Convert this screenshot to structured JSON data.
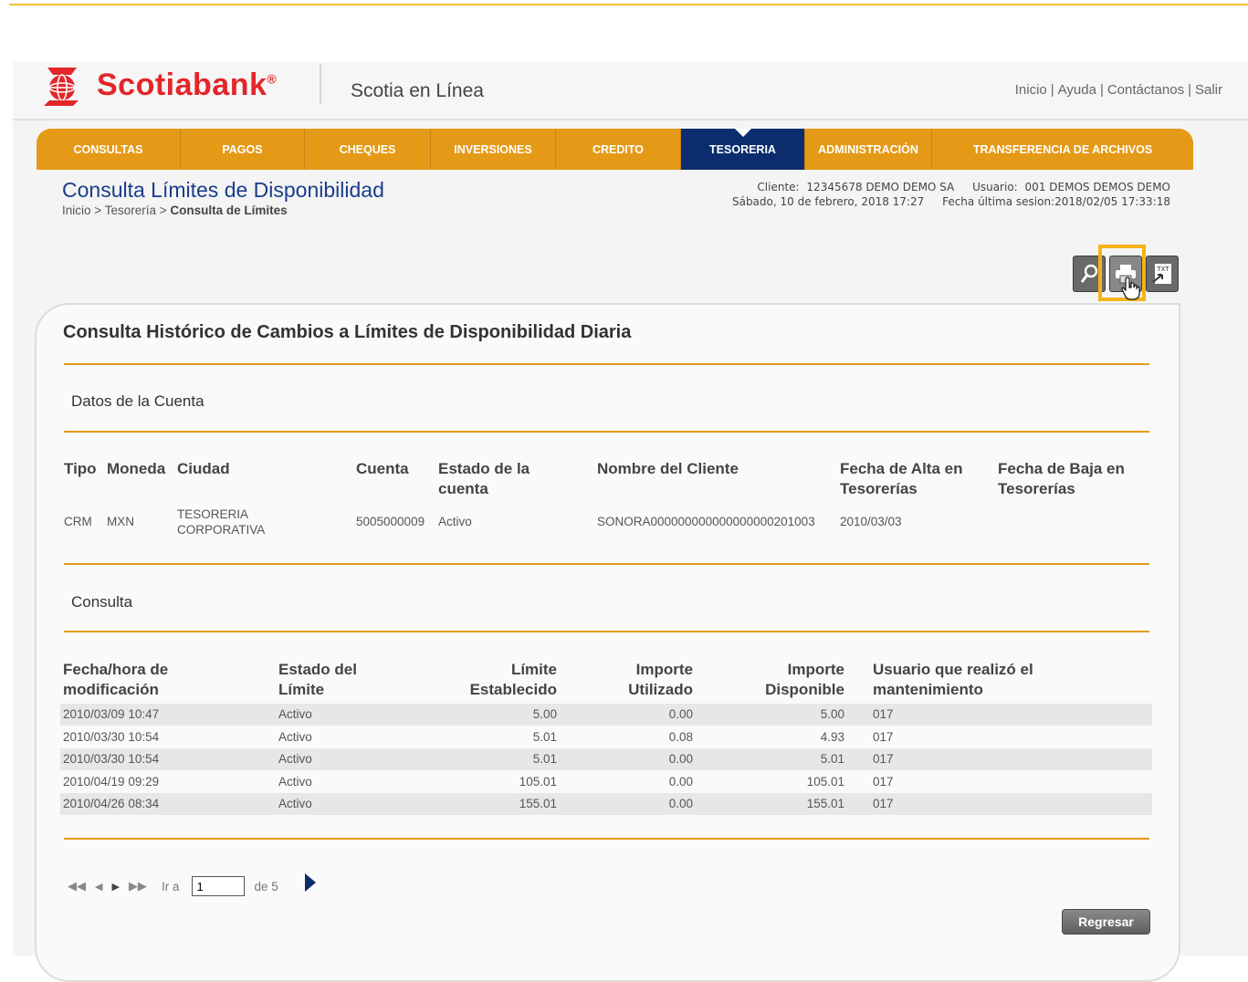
{
  "header": {
    "brand": "Scotiabank",
    "brand_mark": "®",
    "product": "Scotia en Línea",
    "links": [
      "Inicio",
      "Ayuda",
      "Contáctanos",
      "Salir"
    ]
  },
  "nav": {
    "items": [
      "CONSULTAS",
      "PAGOS",
      "CHEQUES",
      "INVERSIONES",
      "CREDITO",
      "TESORERIA",
      "ADMINISTRACIÓN",
      "TRANSFERENCIA DE ARCHIVOS"
    ],
    "active": "TESORERIA"
  },
  "page": {
    "title": "Consulta Límites de Disponibilidad",
    "breadcrumb": {
      "home": "Inicio",
      "sep": ">",
      "section": "Tesorería",
      "current": "Consulta de Límites"
    }
  },
  "session": {
    "cliente_label": "Cliente:",
    "cliente": "12345678 DEMO DEMO SA",
    "usuario_label": "Usuario:",
    "usuario": "001 DEMOS DEMOS DEMO",
    "fecha": "Sábado, 10 de febrero, 2018 17:27",
    "ultima_label": "Fecha última sesion:",
    "ultima": "2018/02/05 17:33:18"
  },
  "tools": {
    "icons": [
      "search-icon",
      "print-icon",
      "txt-export-icon"
    ],
    "txt_label": "TXT"
  },
  "panel": {
    "title": "Consulta Histórico de Cambios a Límites de Disponibilidad Diaria",
    "account_section": "Datos de la Cuenta",
    "account_headers": {
      "tipo": "Tipo",
      "moneda": "Moneda",
      "ciudad": "Ciudad",
      "cuenta": "Cuenta",
      "estado": "Estado de la cuenta",
      "nombre": "Nombre del Cliente",
      "alta": "Fecha de Alta en Tesorerías",
      "baja": "Fecha de Baja en Tesorerías"
    },
    "account_row": {
      "tipo": "CRM",
      "moneda": "MXN",
      "ciudad": "TESORERIA CORPORATIVA",
      "cuenta": "5005000009",
      "estado": "Activo",
      "nombre": "SONORA000000000000000000201003",
      "alta": "2010/03/03",
      "baja": ""
    },
    "query_section": "Consulta",
    "table_headers": {
      "fecha": "Fecha/hora de modificación",
      "estado": "Estado del Límite",
      "limite": "Límite Establecido",
      "utilizado": "Importe Utilizado",
      "disponible": "Importe Disponible",
      "usuario": "Usuario que realizó el mantenimiento"
    },
    "rows": [
      {
        "fecha": "2010/03/09 10:47",
        "estado": "Activo",
        "limite": "5.00",
        "utilizado": "0.00",
        "disponible": "5.00",
        "usuario": "017"
      },
      {
        "fecha": "2010/03/30 10:54",
        "estado": "Activo",
        "limite": "5.01",
        "utilizado": "0.08",
        "disponible": "4.93",
        "usuario": "017"
      },
      {
        "fecha": "2010/03/30 10:54",
        "estado": "Activo",
        "limite": "5.01",
        "utilizado": "0.00",
        "disponible": "5.01",
        "usuario": "017"
      },
      {
        "fecha": "2010/04/19 09:29",
        "estado": "Activo",
        "limite": "105.01",
        "utilizado": "0.00",
        "disponible": "105.01",
        "usuario": "017"
      },
      {
        "fecha": "2010/04/26 08:34",
        "estado": "Activo",
        "limite": "155.01",
        "utilizado": "0.00",
        "disponible": "155.01",
        "usuario": "017"
      }
    ]
  },
  "pager": {
    "goto_label": "Ir a",
    "page_value": "1",
    "of_label": "de 5"
  },
  "back_button": "Regresar",
  "colors": {
    "brand_red": "#e3262a",
    "nav_orange": "#e49a17",
    "nav_active": "#0b2d6e",
    "title_blue": "#1a3d8a",
    "highlight": "#f3b417"
  }
}
